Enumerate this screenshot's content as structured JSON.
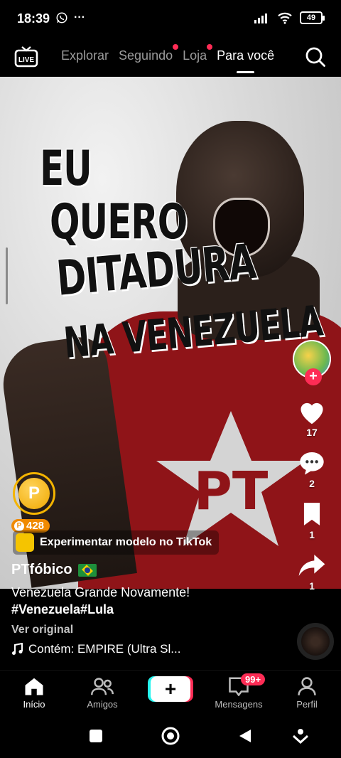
{
  "status_bar": {
    "time": "18:39",
    "more": "···",
    "battery": "49"
  },
  "top_nav": {
    "live_label": "LIVE",
    "tabs": [
      {
        "label": "Explorar",
        "dot": false
      },
      {
        "label": "Seguindo",
        "dot": true
      },
      {
        "label": "Loja",
        "dot": true
      },
      {
        "label": "Para você",
        "dot": false,
        "active": true
      }
    ]
  },
  "video": {
    "overlay_lines": [
      "EU",
      "QUERO",
      "DITADURA",
      "NA VENEZUELA"
    ],
    "shirt_logo_text": "PT"
  },
  "right_rail": {
    "likes": "17",
    "comments": "2",
    "bookmarks": "1",
    "shares": "1"
  },
  "coin": {
    "symbol": "P",
    "amount": "428"
  },
  "template_pill": {
    "label": "Experimentar modelo no TikTok"
  },
  "caption": {
    "username": "PTfóbico",
    "description": "Venezuela Grande Novamente!",
    "hashtags": "#Venezuela#Lula",
    "see_original": "Ver original",
    "music": "Contém: EMPIRE (Ultra Sl..."
  },
  "bottom_nav": {
    "items": [
      {
        "label": "Início",
        "icon": "home-icon"
      },
      {
        "label": "Amigos",
        "icon": "friends-icon"
      },
      {
        "label": "+",
        "icon": "create-icon"
      },
      {
        "label": "Mensagens",
        "icon": "inbox-icon",
        "badge": "99+"
      },
      {
        "label": "Perfil",
        "icon": "profile-icon"
      }
    ]
  },
  "colors": {
    "accent": "#fe2c55",
    "cyan": "#25f4ee",
    "coin": "#f4b400",
    "shirt": "#8f1418"
  }
}
